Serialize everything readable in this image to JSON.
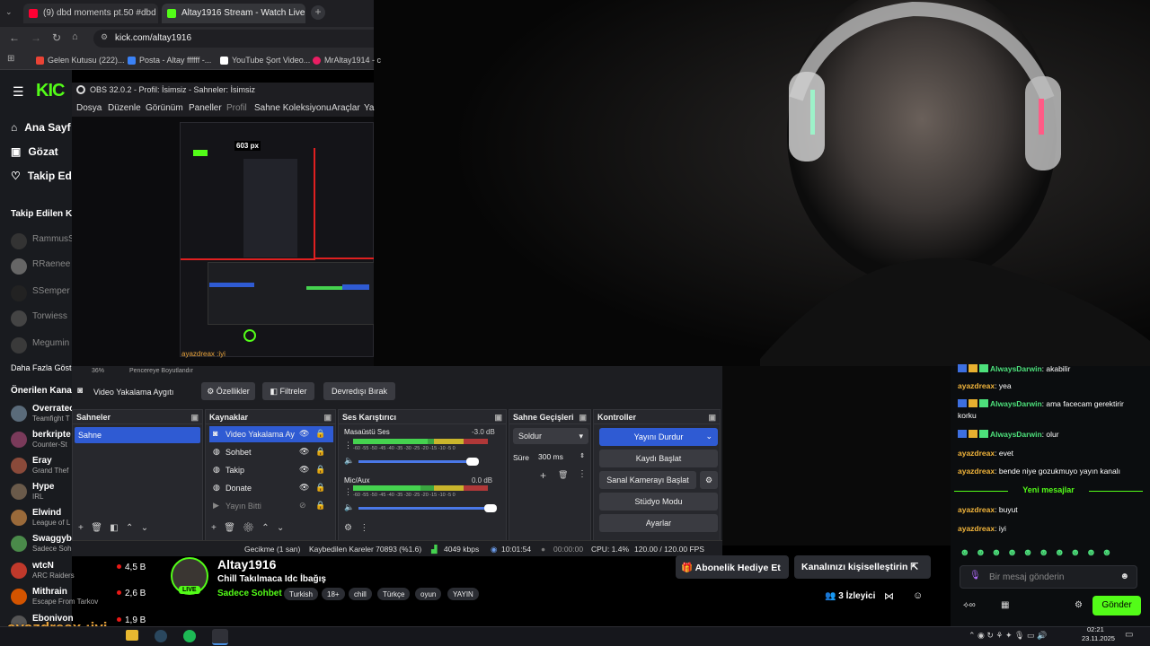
{
  "browser": {
    "tabs": [
      {
        "title": "(9) dbd moments pt.50 #dbd",
        "active": false
      },
      {
        "title": "Altay1916 Stream - Watch Live",
        "active": true
      }
    ],
    "url": "kick.com/altay1916",
    "bookmarks": [
      "Gelen Kutusu (222)...",
      "Posta - Altay ffffff -...",
      "YouTube Şort Video...",
      "MrAltay1914 - c"
    ]
  },
  "kick": {
    "logo": "KIC",
    "nav": [
      "Ana Sayf",
      "Gözat",
      "Takip Ed"
    ],
    "followed_title": "Takip Edilen Ka",
    "followed": [
      "RammusS",
      "RRaenee",
      "SSemper",
      "Torwiess",
      "Megumin"
    ],
    "show_more": "Daha Fazla Göste",
    "recommended_title": "Önerilen Kanal",
    "recommended": [
      {
        "name": "Overratec",
        "game": "Teamfight T",
        "viewers": ""
      },
      {
        "name": "berkripte",
        "game": "Counter-St",
        "viewers": ""
      },
      {
        "name": "Eray",
        "game": "Grand Thef",
        "viewers": ""
      },
      {
        "name": "Hype",
        "game": "IRL",
        "viewers": ""
      },
      {
        "name": "Elwind",
        "game": "League of L",
        "viewers": ""
      },
      {
        "name": "Swaggyb",
        "game": "Sadece Soh",
        "viewers": ""
      },
      {
        "name": "wtcN",
        "game": "ARC Raiders",
        "viewers": "4,5 B"
      },
      {
        "name": "Mithrain",
        "game": "Escape From Tarkov",
        "viewers": "2,6 B"
      },
      {
        "name": "Ebonivon",
        "game": "",
        "viewers": "1,9 B"
      }
    ]
  },
  "obs": {
    "title": "OBS 32.0.2 - Profil: İsimsiz - Sahneler: İsimsiz",
    "menu": [
      "Dosya",
      "Düzenle",
      "Görünüm",
      "Paneller",
      "Profil",
      "Sahne Koleksiyonu",
      "Araçlar",
      "Ya"
    ],
    "preview_label": "603 px",
    "zoom": "36%",
    "fit_label": "Pencereye Boyutlandır",
    "source_bar": {
      "name": "Video Yakalama Aygıtı",
      "properties": "Özellikler",
      "filters": "Filtreler",
      "deactivate": "Devredışı Bırak"
    },
    "scenes": {
      "title": "Sahneler",
      "items": [
        "Sahne"
      ]
    },
    "sources": {
      "title": "Kaynaklar",
      "items": [
        "Video Yakalama Ay",
        "Sohbet",
        "Takip",
        "Donate",
        "Yayın Bitti"
      ]
    },
    "mixer": {
      "title": "Ses Karıştırıcı",
      "channels": [
        {
          "name": "Masaüstü Ses",
          "db": "-3.0 dB",
          "level": 0.55
        },
        {
          "name": "Mic/Aux",
          "db": "0.0 dB",
          "level": 0.5
        }
      ],
      "scale": "-60 -55 -50 -45 -40 -35 -30 -25 -20 -15 -10 -5 0"
    },
    "transitions": {
      "title": "Sahne Geçişleri",
      "type": "Soldur",
      "duration_label": "Süre",
      "duration": "300 ms"
    },
    "controls": {
      "title": "Kontroller",
      "stop_stream": "Yayını Durdur",
      "record": "Kaydı Başlat",
      "virtual_cam": "Sanal Kamerayı Başlat",
      "studio": "Stüdyo Modu",
      "settings": "Ayarlar"
    },
    "status": {
      "delay": "Gecikme (1 san)",
      "dropped": "Kaybedilen Kareler 70893 (%1.6)",
      "bitrate": "4049 kbps",
      "live_time": "10:01:54",
      "rec_time": "00:00:00",
      "cpu": "CPU: 1.4%",
      "fps": "120.00 / 120.00 FPS"
    }
  },
  "stream": {
    "streamer": "Altay1916",
    "live_badge": "LIVE",
    "title": "Chill Takılmaca Idc İbağış",
    "category": "Sadece Sohbet",
    "tags": [
      "Turkish",
      "18+",
      "chill",
      "Türkçe",
      "oyun",
      "YAYIN"
    ],
    "gift_sub": "Abonelik Hediye Et",
    "customize": "Kanalınızı kişiselleştirin",
    "viewers": "3 İzleyici",
    "overlay_text": "ayazdreax :iyi"
  },
  "chat": {
    "messages": [
      {
        "user": "AlwaysDarwin",
        "text": "akabilir",
        "badges": true
      },
      {
        "user": "ayazdreax",
        "text": "yea",
        "badges": false
      },
      {
        "user": "AlwaysDarwin",
        "text": "ama facecam gerektirir korku",
        "badges": true
      },
      {
        "user": "AlwaysDarwin",
        "text": "olur",
        "badges": true
      },
      {
        "user": "ayazdreax",
        "text": "evet",
        "badges": false
      },
      {
        "user": "ayazdreax",
        "text": "bende niye gozukmuyo yayın kanalı",
        "badges": false
      }
    ],
    "new_messages": "Yeni mesajlar",
    "messages_after": [
      {
        "user": "ayazdreax",
        "text": "buyut"
      },
      {
        "user": "ayazdreax",
        "text": "iyi"
      }
    ],
    "placeholder": "Bir mesaj gönderin",
    "send": "Gönder"
  },
  "taskbar": {
    "time": "02:21",
    "date": "23.11.2025"
  },
  "colors": {
    "kick_green": "#53fc18",
    "obs_blue": "#2f5bd3",
    "live_red": "#e91916"
  }
}
